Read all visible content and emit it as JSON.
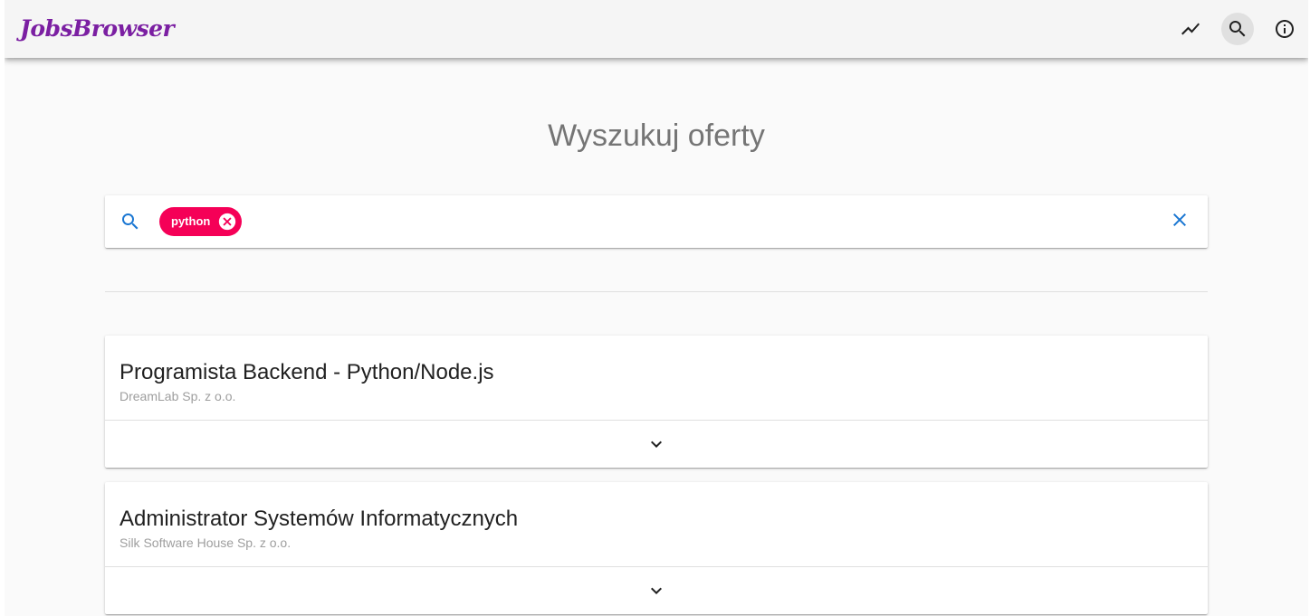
{
  "app": {
    "brand": "JobsBrowser",
    "brand_color": "#7b1fa2",
    "toolbar_icons": [
      "trending-up-icon",
      "search-icon",
      "info-icon"
    ],
    "active_icon": "search-icon"
  },
  "page": {
    "heading": "Wyszukuj oferty"
  },
  "search": {
    "icon": "search-icon",
    "chips": [
      {
        "label": "python",
        "color": "#f50057"
      }
    ],
    "input_value": "",
    "clear_icon": "close-icon",
    "accent_color": "#1976d2"
  },
  "jobs": [
    {
      "title": "Programista Backend - Python/Node.js",
      "company": "DreamLab Sp. z o.o.",
      "expand_icon": "chevron-down-icon"
    },
    {
      "title": "Administrator Systemów Informatycznych",
      "company": "Silk Software House Sp. z o.o.",
      "expand_icon": "chevron-down-icon"
    }
  ]
}
